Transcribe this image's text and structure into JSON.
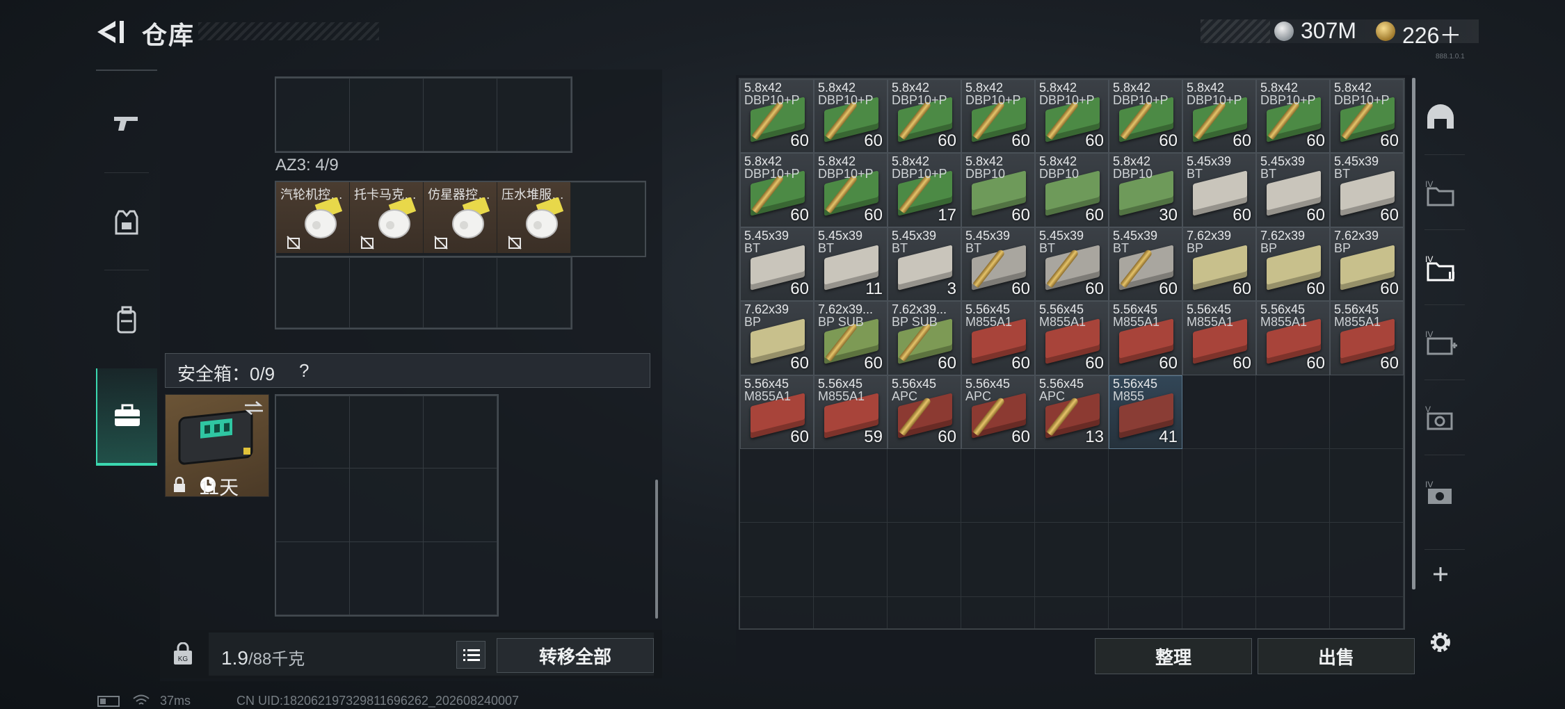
{
  "header": {
    "title": "仓库",
    "currency_silver": "307M",
    "currency_gold": "226＋",
    "version_text": "888.1.0.1"
  },
  "left_tabs": [
    "gun-icon",
    "armor-vest-icon",
    "backpack-icon",
    "briefcase-icon"
  ],
  "container": {
    "az3_label": "AZ3: 4/9",
    "items": [
      {
        "name": "汽轮机控…"
      },
      {
        "name": "托卡马克…"
      },
      {
        "name": "仿星器控…"
      },
      {
        "name": "压水堆服…"
      }
    ]
  },
  "safe_box": {
    "title": "安全箱：0/9",
    "help": "?",
    "days": "11天"
  },
  "weight": {
    "current": "1.9",
    "max": "/88千克"
  },
  "buttons": {
    "transfer_all": "转移全部",
    "sort": "整理",
    "sell": "出售"
  },
  "status": {
    "ping": "37ms",
    "uid": "CN UID:18206219732981169626​2_202608240007"
  },
  "stash": [
    {
      "cal": "5.8x42",
      "var": "DBP10+P",
      "qty": "60",
      "box": "#4c8a45",
      "round": true
    },
    {
      "cal": "5.8x42",
      "var": "DBP10+P",
      "qty": "60",
      "box": "#4c8a45",
      "round": true
    },
    {
      "cal": "5.8x42",
      "var": "DBP10+P",
      "qty": "60",
      "box": "#4c8a45",
      "round": true
    },
    {
      "cal": "5.8x42",
      "var": "DBP10+P",
      "qty": "60",
      "box": "#4c8a45",
      "round": true
    },
    {
      "cal": "5.8x42",
      "var": "DBP10+P",
      "qty": "60",
      "box": "#4c8a45",
      "round": true
    },
    {
      "cal": "5.8x42",
      "var": "DBP10+P",
      "qty": "60",
      "box": "#4c8a45",
      "round": true
    },
    {
      "cal": "5.8x42",
      "var": "DBP10+P",
      "qty": "60",
      "box": "#4c8a45",
      "round": true
    },
    {
      "cal": "5.8x42",
      "var": "DBP10+P",
      "qty": "60",
      "box": "#4c8a45",
      "round": true
    },
    {
      "cal": "5.8x42",
      "var": "DBP10+P",
      "qty": "60",
      "box": "#4c8a45",
      "round": true
    },
    {
      "cal": "5.8x42",
      "var": "DBP10+P",
      "qty": "60",
      "box": "#4c8a45",
      "round": true
    },
    {
      "cal": "5.8x42",
      "var": "DBP10+P",
      "qty": "60",
      "box": "#4c8a45",
      "round": true
    },
    {
      "cal": "5.8x42",
      "var": "DBP10+P",
      "qty": "17",
      "box": "#4c8a45",
      "round": true
    },
    {
      "cal": "5.8x42",
      "var": "DBP10",
      "qty": "60",
      "box": "#6e9a5a",
      "round": false
    },
    {
      "cal": "5.8x42",
      "var": "DBP10",
      "qty": "60",
      "box": "#6e9a5a",
      "round": false
    },
    {
      "cal": "5.8x42",
      "var": "DBP10",
      "qty": "30",
      "box": "#6e9a5a",
      "round": false
    },
    {
      "cal": "5.45x39",
      "var": "BT",
      "qty": "60",
      "box": "#c9c5bb",
      "round": false
    },
    {
      "cal": "5.45x39",
      "var": "BT",
      "qty": "60",
      "box": "#c9c5bb",
      "round": false
    },
    {
      "cal": "5.45x39",
      "var": "BT",
      "qty": "60",
      "box": "#c9c5bb",
      "round": false
    },
    {
      "cal": "5.45x39",
      "var": "BT",
      "qty": "60",
      "box": "#c9c5bb",
      "round": false
    },
    {
      "cal": "5.45x39",
      "var": "BT",
      "qty": "11",
      "box": "#c9c5bb",
      "round": false
    },
    {
      "cal": "5.45x39",
      "var": "BT",
      "qty": "3",
      "box": "#c9c5bb",
      "round": false
    },
    {
      "cal": "5.45x39",
      "var": "BT",
      "qty": "60",
      "box": "#a9a69f",
      "round": true
    },
    {
      "cal": "5.45x39",
      "var": "BT",
      "qty": "60",
      "box": "#a9a69f",
      "round": true
    },
    {
      "cal": "5.45x39",
      "var": "BT",
      "qty": "60",
      "box": "#a9a69f",
      "round": true
    },
    {
      "cal": "7.62x39",
      "var": "BP",
      "qty": "60",
      "box": "#c8c08c",
      "round": false
    },
    {
      "cal": "7.62x39",
      "var": "BP",
      "qty": "60",
      "box": "#c8c08c",
      "round": false
    },
    {
      "cal": "7.62x39",
      "var": "BP",
      "qty": "60",
      "box": "#c8c08c",
      "round": false
    },
    {
      "cal": "7.62x39",
      "var": "BP",
      "qty": "60",
      "box": "#c8c08c",
      "round": false
    },
    {
      "cal": "7.62x39...",
      "var": "BP SUB",
      "qty": "60",
      "box": "#7d9a55",
      "round": true
    },
    {
      "cal": "7.62x39...",
      "var": "BP SUB",
      "qty": "60",
      "box": "#7d9a55",
      "round": true
    },
    {
      "cal": "5.56x45",
      "var": "M855A1",
      "qty": "60",
      "box": "#a8443a",
      "round": false
    },
    {
      "cal": "5.56x45",
      "var": "M855A1",
      "qty": "60",
      "box": "#a8443a",
      "round": false
    },
    {
      "cal": "5.56x45",
      "var": "M855A1",
      "qty": "60",
      "box": "#a8443a",
      "round": false
    },
    {
      "cal": "5.56x45",
      "var": "M855A1",
      "qty": "60",
      "box": "#a8443a",
      "round": false
    },
    {
      "cal": "5.56x45",
      "var": "M855A1",
      "qty": "60",
      "box": "#a8443a",
      "round": false
    },
    {
      "cal": "5.56x45",
      "var": "M855A1",
      "qty": "60",
      "box": "#a8443a",
      "round": false
    },
    {
      "cal": "5.56x45",
      "var": "M855A1",
      "qty": "60",
      "box": "#a8443a",
      "round": false
    },
    {
      "cal": "5.56x45",
      "var": "M855A1",
      "qty": "59",
      "box": "#a8443a",
      "round": false
    },
    {
      "cal": "5.56x45",
      "var": "APC",
      "qty": "60",
      "box": "#8c3a32",
      "round": true
    },
    {
      "cal": "5.56x45",
      "var": "APC",
      "qty": "60",
      "box": "#8c3a32",
      "round": true
    },
    {
      "cal": "5.56x45",
      "var": "APC",
      "qty": "13",
      "box": "#8c3a32",
      "round": true
    },
    {
      "cal": "5.56x45",
      "var": "M855",
      "qty": "41",
      "box": "#8a3d35",
      "round": false,
      "selected": true
    }
  ],
  "right_tabs": [
    "helmet-icon",
    "folder-iv-icon",
    "folder-iv-active-icon",
    "medkit-iv-icon",
    "camera-v-icon",
    "camera-iv-icon",
    "add-icon",
    "settings-icon"
  ]
}
